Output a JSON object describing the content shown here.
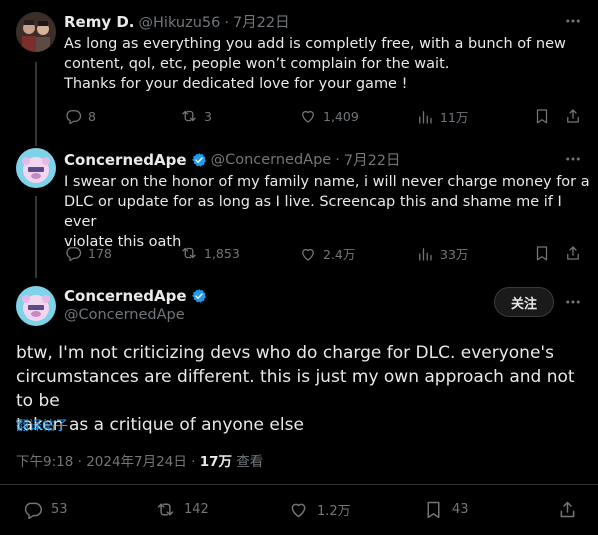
{
  "tweet1": {
    "name": "Remy D.",
    "handle": "@Hikuzu56",
    "dot": "·",
    "date": "7月22日",
    "lines": [
      "As long as everything you add is completly free, with a bunch of new",
      "content, qol, etc, people won’t complain for the wait.",
      "Thanks for your dedicated love for your game !"
    ],
    "replies": "8",
    "reposts": "3",
    "likes": "1,409",
    "views": "11万"
  },
  "tweet2": {
    "name": "ConcernedApe",
    "handle": "@ConcernedApe",
    "dot": "·",
    "date": "7月22日",
    "lines": [
      "I swear on the honor of my family name,  i will never charge money for a",
      "DLC or update for as long as I live. Screencap this and shame me if I ever",
      "violate this oath"
    ],
    "replies": "178",
    "reposts": "1,853",
    "likes": "2.4万",
    "views": "33万"
  },
  "main": {
    "name": "ConcernedApe",
    "handle": "@ConcernedApe",
    "follow_label": "关注",
    "lines": [
      "btw, I'm not criticizing devs who do charge for DLC. everyone's",
      "circumstances are different. this is just my own approach and not to be",
      "taken as a critique of anyone else"
    ],
    "translate_label": "翻译帖子",
    "time": "下午9:18 · 2024年7月24日 · ",
    "views_count": "17万",
    "views_label": " 查看",
    "replies": "53",
    "reposts": "142",
    "likes": "1.2万",
    "bookmarks": "43"
  },
  "colors": {
    "background": "#000000",
    "text": "#e7e9ea",
    "muted": "#71767b",
    "link": "#1d9bf0",
    "verified": "#1d9bf0",
    "divider": "#2f3336"
  },
  "icons": [
    "reply-icon",
    "repost-icon",
    "like-icon",
    "views-icon",
    "bookmark-icon",
    "share-icon",
    "more-icon",
    "verified-badge-icon"
  ]
}
